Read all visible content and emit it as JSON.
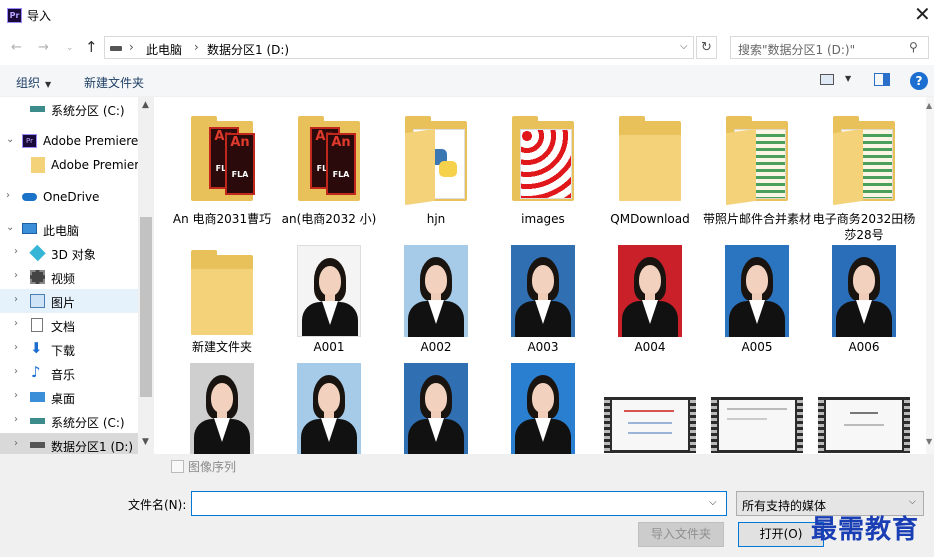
{
  "window": {
    "title": "导入",
    "app_icon": "Pr"
  },
  "address": {
    "crumbs": [
      "此电脑",
      "数据分区1 (D:)"
    ],
    "search_placeholder": "搜索\"数据分区1 (D:)\""
  },
  "toolbar": {
    "organize": "组织",
    "new_folder": "新建文件夹"
  },
  "nav": {
    "items": [
      {
        "label": "系统分区 (C:)",
        "icon": "drive-icon"
      },
      {
        "label": "Adobe Premiere",
        "icon": "premiere-icon"
      },
      {
        "label": "Adobe Premier",
        "icon": "folder-icon"
      },
      {
        "label": "OneDrive",
        "icon": "cloud-icon"
      },
      {
        "label": "此电脑",
        "icon": "pc-icon"
      },
      {
        "label": "3D 对象",
        "icon": "3d-icon"
      },
      {
        "label": "视频",
        "icon": "video-icon"
      },
      {
        "label": "图片",
        "icon": "pictures-icon"
      },
      {
        "label": "文档",
        "icon": "documents-icon"
      },
      {
        "label": "下载",
        "icon": "download-icon"
      },
      {
        "label": "音乐",
        "icon": "music-icon"
      },
      {
        "label": "桌面",
        "icon": "desktop-icon"
      },
      {
        "label": "系统分区 (C:)",
        "icon": "drive-icon"
      },
      {
        "label": "数据分区1 (D:)",
        "icon": "drive-icon"
      }
    ]
  },
  "files": {
    "row1": [
      "An 电商2031曹巧",
      "an(电商2032 小)",
      "hjn",
      "images",
      "QMDownload",
      "带照片邮件合并素材",
      "电子商务2032田杨莎28号"
    ],
    "row2": [
      "新建文件夹",
      "A001",
      "A002",
      "A003",
      "A004",
      "A005",
      "A006"
    ]
  },
  "bottom": {
    "sequence_label": "图像序列",
    "filename_label": "文件名(N):",
    "filename_value": "",
    "filetype": "所有支持的媒体",
    "import_folder": "导入文件夹",
    "open": "打开(O)",
    "watermark": "最需教育"
  },
  "colors": {
    "accent": "#0078d7",
    "help": "#1c6fd1",
    "watermark": "#1a3fb5"
  }
}
